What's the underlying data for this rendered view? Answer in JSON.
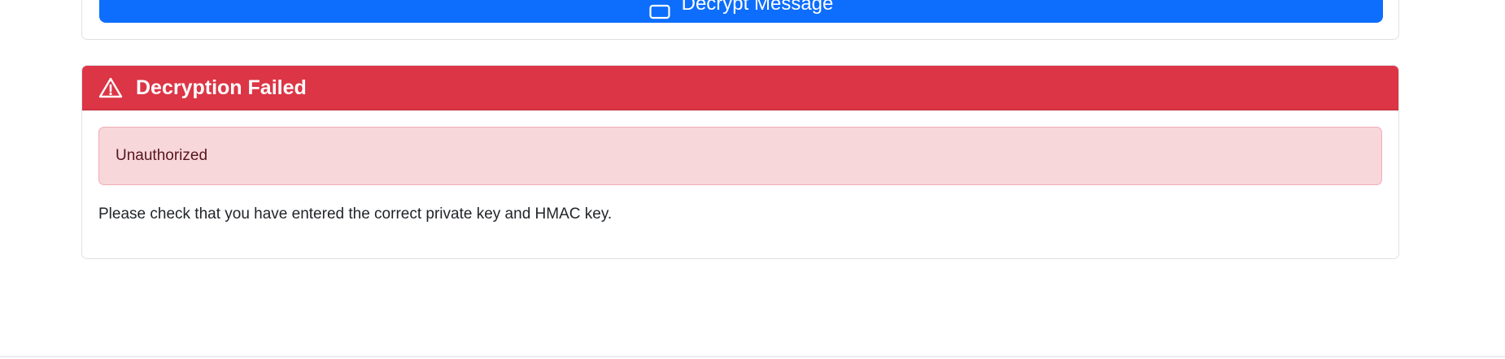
{
  "decrypt_form": {
    "submit_label": "Decrypt Message",
    "submit_icon": "unlock-icon"
  },
  "result": {
    "header_icon": "warning-triangle-icon",
    "title": "Decryption Failed",
    "error_message": "Unauthorized",
    "help_text": "Please check that you have entered the correct private key and HMAC key.",
    "colors": {
      "danger": "#dc3545",
      "primary": "#0d6efd",
      "alert_background": "#f8d7da",
      "alert_text": "#58151c"
    }
  }
}
